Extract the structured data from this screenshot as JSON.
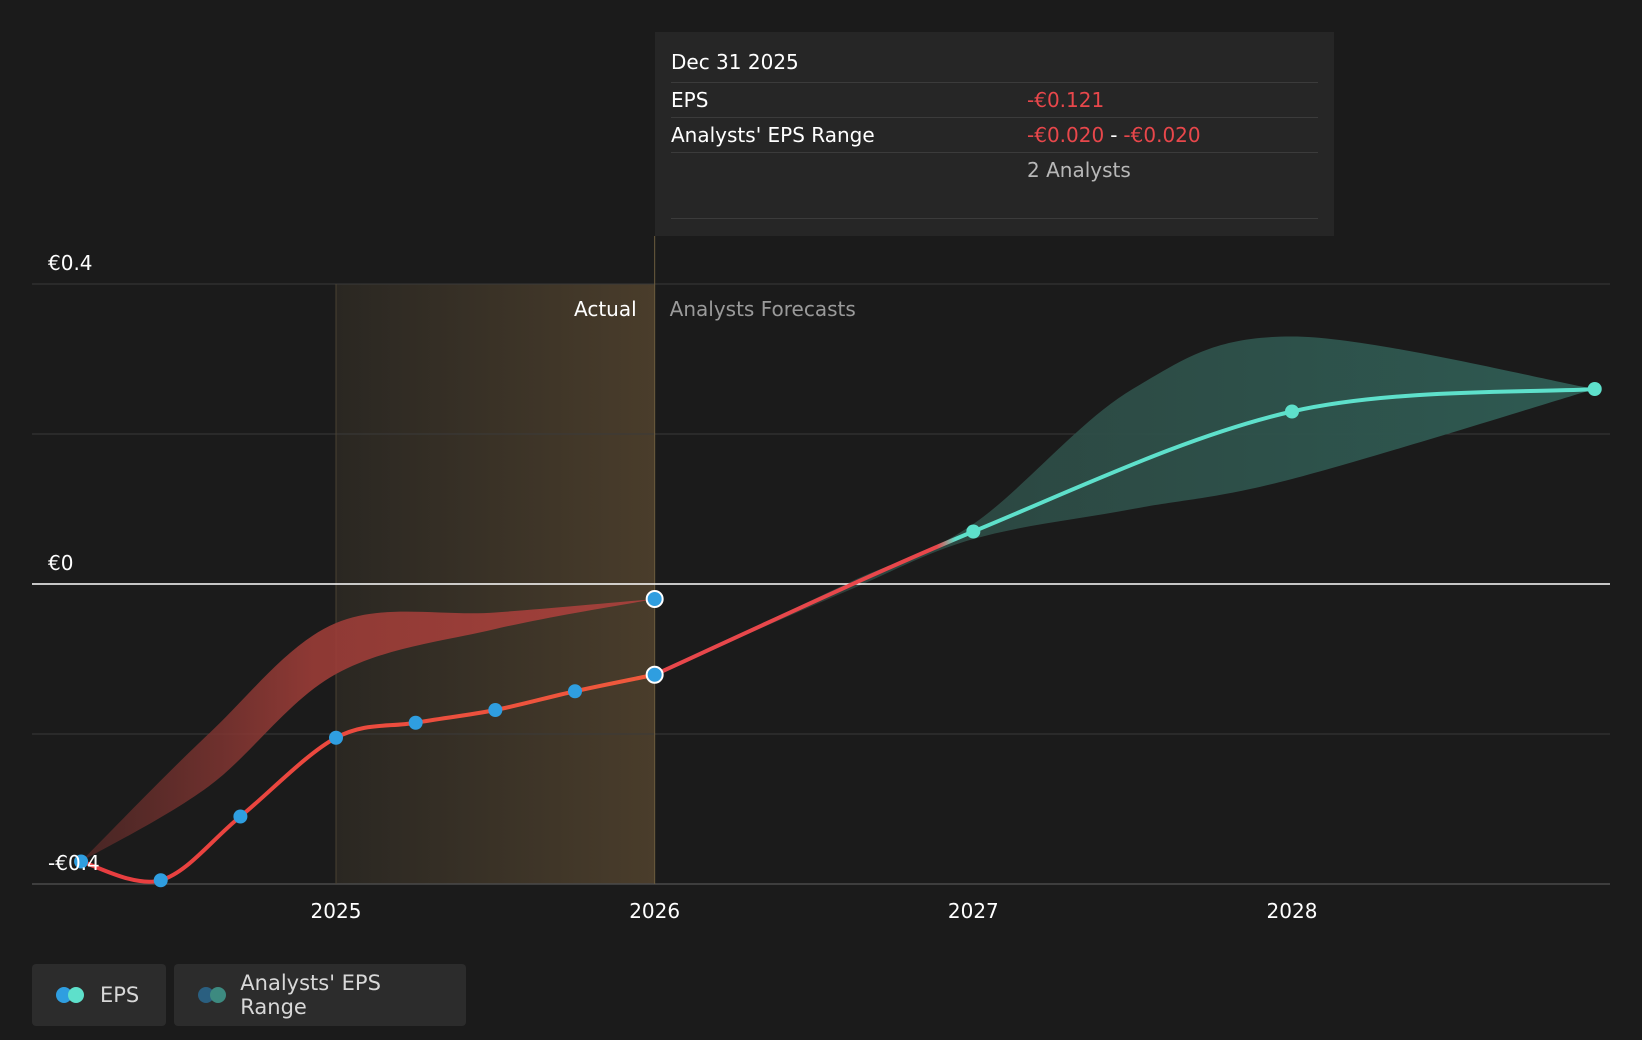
{
  "chart_data": {
    "type": "line",
    "y_ticks": [
      {
        "value": 0.4,
        "label": "€0.4"
      },
      {
        "value": 0,
        "label": "€0"
      },
      {
        "value": -0.4,
        "label": "-€0.4"
      }
    ],
    "ylim": [
      -0.4,
      0.4
    ],
    "x_ticks": [
      {
        "value": 2025,
        "label": "2025"
      },
      {
        "value": 2026,
        "label": "2026"
      },
      {
        "value": 2027,
        "label": "2027"
      },
      {
        "value": 2028,
        "label": "2028"
      }
    ],
    "xlim": [
      2024.045,
      2028.95
    ],
    "grid": true,
    "regions": {
      "actual_label": "Actual",
      "forecast_label": "Analysts Forecasts",
      "actual_start": 2025.0,
      "divider": 2026.0
    },
    "series": [
      {
        "name": "EPS",
        "segment": "actual",
        "color": "#e8474b",
        "points": [
          {
            "x": 2024.2,
            "y": -0.37
          },
          {
            "x": 2024.45,
            "y": -0.395
          },
          {
            "x": 2024.7,
            "y": -0.31
          },
          {
            "x": 2025.0,
            "y": -0.205
          },
          {
            "x": 2025.25,
            "y": -0.185
          },
          {
            "x": 2025.5,
            "y": -0.168
          },
          {
            "x": 2025.75,
            "y": -0.143
          },
          {
            "x": 2026.0,
            "y": -0.121
          }
        ]
      },
      {
        "name": "EPS",
        "segment": "forecast",
        "color": "#5ee0cb",
        "points": [
          {
            "x": 2026.0,
            "y": -0.121
          },
          {
            "x": 2027.0,
            "y": 0.07
          },
          {
            "x": 2028.0,
            "y": 0.23
          },
          {
            "x": 2028.95,
            "y": 0.26
          }
        ]
      }
    ],
    "range_bands": [
      {
        "name": "Analysts' EPS Range",
        "segment": "past",
        "color": "#a8413c",
        "upper": [
          {
            "x": 2024.2,
            "y": -0.37
          },
          {
            "x": 2024.6,
            "y": -0.2
          },
          {
            "x": 2025.0,
            "y": -0.052
          },
          {
            "x": 2025.5,
            "y": -0.038
          },
          {
            "x": 2026.0,
            "y": -0.02
          }
        ],
        "lower": [
          {
            "x": 2024.2,
            "y": -0.37
          },
          {
            "x": 2024.6,
            "y": -0.27
          },
          {
            "x": 2025.0,
            "y": -0.12
          },
          {
            "x": 2025.5,
            "y": -0.06
          },
          {
            "x": 2026.0,
            "y": -0.02
          }
        ]
      },
      {
        "name": "Analysts' EPS Range",
        "segment": "forecast",
        "color": "#2e5a52",
        "upper": [
          {
            "x": 2026.0,
            "y": -0.121
          },
          {
            "x": 2026.6,
            "y": 0.0
          },
          {
            "x": 2027.0,
            "y": 0.08
          },
          {
            "x": 2027.5,
            "y": 0.26
          },
          {
            "x": 2028.0,
            "y": 0.33
          },
          {
            "x": 2028.95,
            "y": 0.26
          }
        ],
        "lower": [
          {
            "x": 2026.0,
            "y": -0.121
          },
          {
            "x": 2026.6,
            "y": -0.01
          },
          {
            "x": 2027.0,
            "y": 0.06
          },
          {
            "x": 2027.5,
            "y": 0.1
          },
          {
            "x": 2028.0,
            "y": 0.14
          },
          {
            "x": 2028.95,
            "y": 0.26
          }
        ]
      }
    ],
    "highlight_points": [
      {
        "x": 2026.0,
        "y": -0.02
      },
      {
        "x": 2026.0,
        "y": -0.121
      }
    ],
    "tooltip": {
      "date": "Dec 31 2025",
      "eps_label": "EPS",
      "eps_value": "-€0.121",
      "range_label": "Analysts' EPS Range",
      "range_low": "-€0.020",
      "range_sep": "-",
      "range_high": "-€0.020",
      "analysts": "2 Analysts"
    }
  },
  "legend": [
    {
      "label": "EPS",
      "colors": [
        "#2f9ee0",
        "#5ee0cb"
      ]
    },
    {
      "label": "Analysts' EPS Range",
      "colors": [
        "#2a5f80",
        "#3d8a80"
      ]
    }
  ]
}
